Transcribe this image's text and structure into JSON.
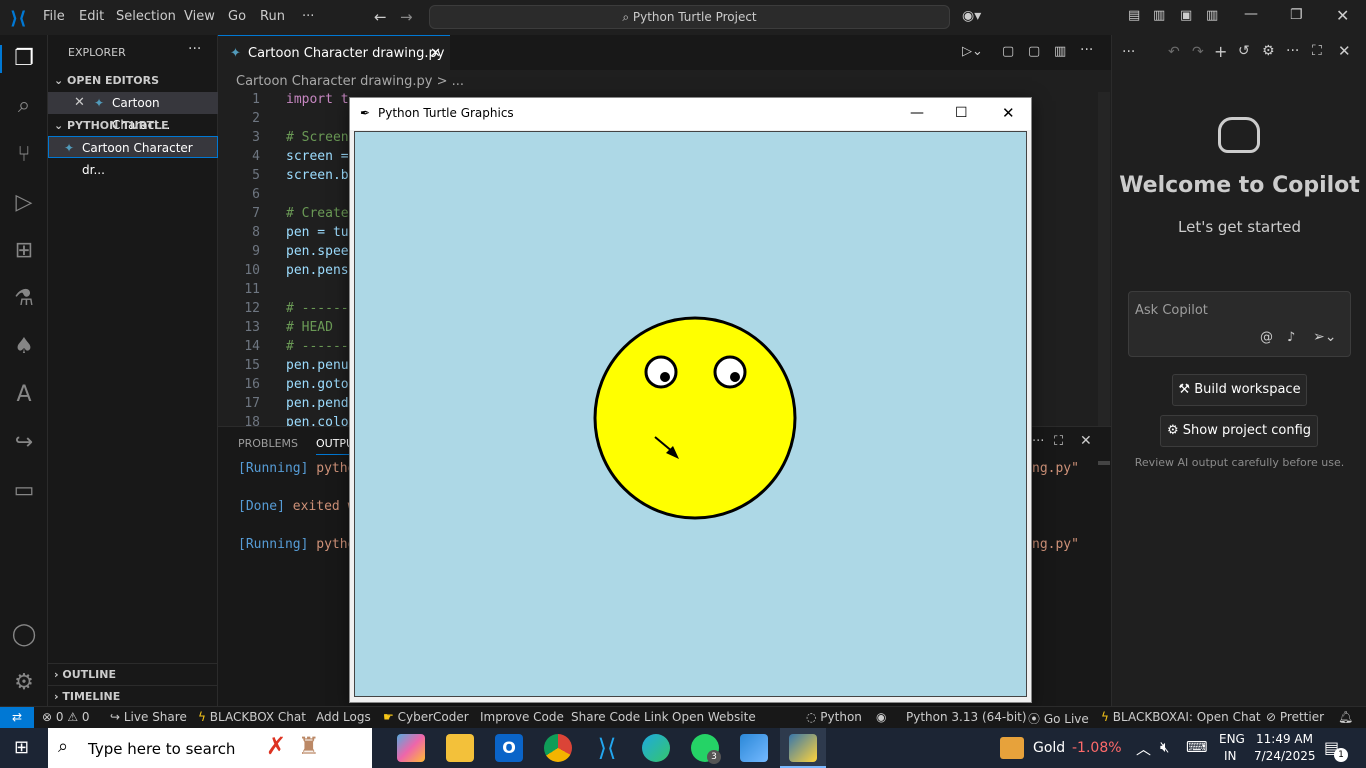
{
  "titlebar": {
    "menus": [
      "File",
      "Edit",
      "Selection",
      "View",
      "Go",
      "Run",
      "···"
    ],
    "command_center": "Python Turtle Project"
  },
  "sidebar": {
    "title": "EXPLORER",
    "open_editors": "OPEN EDITORS",
    "open_file": "Cartoon Charact...",
    "project": "PYTHON TURTLE PROJECT",
    "project_file": "Cartoon Character dr...",
    "outline": "OUTLINE",
    "timeline": "TIMELINE"
  },
  "editor": {
    "tab_label": "Cartoon Character drawing.py",
    "breadcrumb": "Cartoon Character drawing.py > ...",
    "lines": [
      {
        "n": "1",
        "t": "import t"
      },
      {
        "n": "2",
        "t": ""
      },
      {
        "n": "3",
        "t": "# Screen"
      },
      {
        "n": "4",
        "t": "screen ="
      },
      {
        "n": "5",
        "t": "screen.b"
      },
      {
        "n": "6",
        "t": ""
      },
      {
        "n": "7",
        "t": "# Create"
      },
      {
        "n": "8",
        "t": "pen = tu"
      },
      {
        "n": "9",
        "t": "pen.spee"
      },
      {
        "n": "10",
        "t": "pen.pens"
      },
      {
        "n": "11",
        "t": ""
      },
      {
        "n": "12",
        "t": "# ------"
      },
      {
        "n": "13",
        "t": "# HEAD"
      },
      {
        "n": "14",
        "t": "# ------"
      },
      {
        "n": "15",
        "t": "pen.penu"
      },
      {
        "n": "16",
        "t": "pen.goto"
      },
      {
        "n": "17",
        "t": "pen.pend"
      },
      {
        "n": "18",
        "t": "pen.colo"
      }
    ]
  },
  "panel": {
    "tabs": [
      "PROBLEMS",
      "OUTPU"
    ],
    "output": [
      {
        "a": "[Running]",
        "b": " pytho",
        "c": "ng.py\""
      },
      {
        "a": "[Done]",
        "b": " exited w",
        "c": ""
      },
      {
        "a": "[Running]",
        "b": " pytho",
        "c": "ng.py\""
      }
    ]
  },
  "turtle_window": {
    "title": "Python Turtle Graphics",
    "bg": "#add8e6",
    "face_color": "#ffff00"
  },
  "copilot": {
    "heading": "Welcome to Copilot",
    "sub": "Let's get started",
    "placeholder": "Ask Copilot",
    "build_btn": "Build workspace",
    "config_btn": "Show project config",
    "note": "Review AI output carefully before use."
  },
  "status": {
    "errors": "0",
    "warnings": "0",
    "items": [
      "Live Share",
      "BLACKBOX Chat",
      "Add Logs",
      "CyberCoder",
      "Improve Code",
      "Share Code Link",
      "Open Website"
    ],
    "lang": "Python",
    "interpreter": "Python 3.13 (64-bit)",
    "golive": "Go Live",
    "blackbox_ai": "BLACKBOXAI: Open Chat",
    "prettier": "Prettier"
  },
  "taskbar": {
    "search": "Type here to search",
    "stock": "Gold",
    "stock_change": "-1.08%",
    "lang1": "ENG",
    "lang2": "IN",
    "time": "11:49 AM",
    "date": "7/24/2025",
    "notif": "1",
    "whatsapp_badge": "3"
  }
}
